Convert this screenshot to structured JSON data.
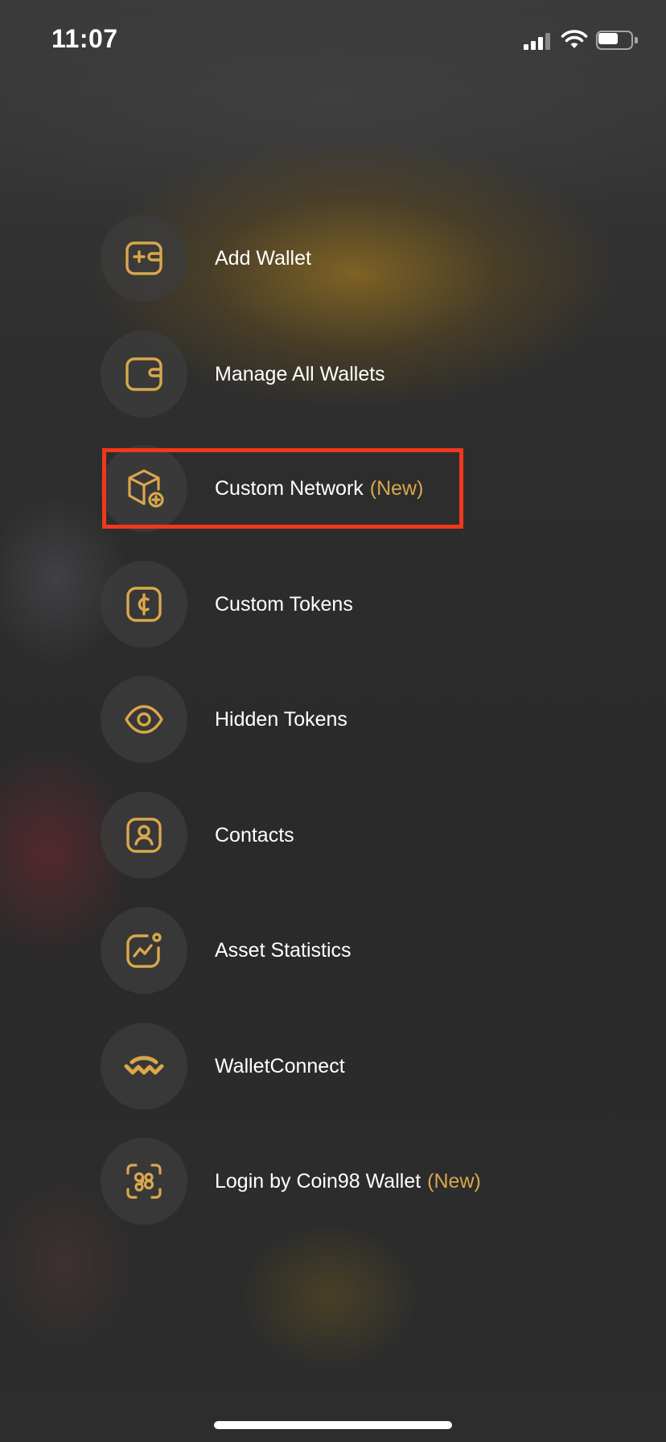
{
  "status_bar": {
    "time": "11:07",
    "battery_level_fraction": 0.6,
    "signal_bars_active": 3
  },
  "colors": {
    "accent": "#d9a74c",
    "highlight": "#f0381c",
    "text": "#ffffff"
  },
  "menu": {
    "items": [
      {
        "label": "Add Wallet",
        "icon": "add-wallet-icon",
        "badge": ""
      },
      {
        "label": "Manage All Wallets",
        "icon": "wallet-icon",
        "badge": ""
      },
      {
        "label": "Custom Network",
        "icon": "cube-plus-icon",
        "badge": "(New)"
      },
      {
        "label": "Custom Tokens",
        "icon": "coin-icon",
        "badge": ""
      },
      {
        "label": "Hidden Tokens",
        "icon": "eye-icon",
        "badge": ""
      },
      {
        "label": "Contacts",
        "icon": "contact-icon",
        "badge": ""
      },
      {
        "label": "Asset Statistics",
        "icon": "chart-icon",
        "badge": ""
      },
      {
        "label": "WalletConnect",
        "icon": "walletconnect-icon",
        "badge": ""
      },
      {
        "label": "Login by Coin98 Wallet",
        "icon": "scan-login-icon",
        "badge": "(New)"
      }
    ]
  }
}
